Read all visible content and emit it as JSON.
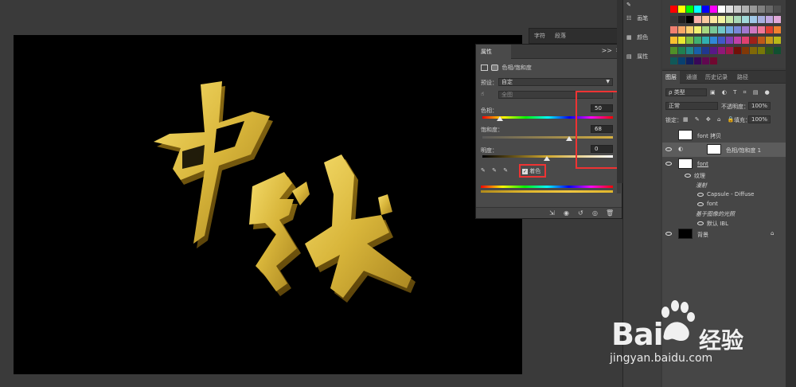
{
  "canvas": {
    "artwork_text": "中秋",
    "artwork_color": "#d8b53a"
  },
  "char_panel": {
    "tabs": [
      "字符",
      "段落"
    ]
  },
  "properties": {
    "tab": "属性",
    "menu": ">>",
    "close": "×",
    "adjustment_name": "色相/饱和度",
    "preset_label": "预设：",
    "preset_value": "自定",
    "channel_value": "全图",
    "hue_label": "色相：",
    "hue_value": "50",
    "sat_label": "饱和度：",
    "sat_value": "68",
    "light_label": "明度：",
    "light_value": "0",
    "colorize_label": "着色",
    "colorize_checked": true,
    "footer_icons": [
      "clip-icon",
      "visibility-preview-icon",
      "reset-icon",
      "eye-icon",
      "trash-icon"
    ]
  },
  "strip": {
    "items": [
      {
        "icon": "brush-icon",
        "label": ""
      },
      {
        "icon": "brush-presets-icon",
        "label": "画笔"
      },
      {
        "icon": "swatches-icon",
        "label": "颜色"
      },
      {
        "icon": "properties-icon",
        "label": "属性"
      }
    ]
  },
  "swatch_colors": [
    "#ff0000",
    "#ffff00",
    "#00ff00",
    "#00ffff",
    "#0000ff",
    "#ff00ff",
    "#ffffff",
    "#e0e0e0",
    "#c8c8c8",
    "#b0b0b0",
    "#989898",
    "#808080",
    "#686868",
    "#505050",
    "#383838",
    "#202020",
    "#000000",
    "#f7b0a8",
    "#f9c8a0",
    "#fce7a0",
    "#f4f4a0",
    "#c8e8a8",
    "#a8d8b8",
    "#a0d8d8",
    "#a0c8e8",
    "#a8b0e0",
    "#c0a8e0",
    "#e0a8d8",
    "#f08070",
    "#f8a868",
    "#fcd070",
    "#f0f070",
    "#a8d880",
    "#78c898",
    "#70c8c8",
    "#70a8e0",
    "#7888d8",
    "#a078d0",
    "#d078c0",
    "#f07898",
    "#e04030",
    "#f08030",
    "#f8c030",
    "#e8e830",
    "#80c040",
    "#40b070",
    "#30b0b0",
    "#3088d8",
    "#4058c8",
    "#8040b8",
    "#c040a8",
    "#e04070",
    "#a02018",
    "#c05818",
    "#c89818",
    "#b8b818",
    "#509028",
    "#208050",
    "#208888",
    "#1860a8",
    "#203890",
    "#581888",
    "#901878",
    "#a01848",
    "#701008",
    "#803808",
    "#806808",
    "#787808",
    "#305818",
    "#105030",
    "#105858",
    "#084070",
    "#102060",
    "#380858",
    "#600850",
    "#700830"
  ],
  "layers": {
    "tabs": [
      "图层",
      "通道",
      "历史记录",
      "路径"
    ],
    "filter_label": "类型",
    "blend_mode": "正常",
    "opacity_label": "不透明度：",
    "opacity_value": "100%",
    "lock_label": "锁定：",
    "fill_label": "填充：",
    "fill_value": "100%",
    "items": [
      {
        "name": "font 拷贝",
        "kind": "smart"
      },
      {
        "name": "色相/饱和度 1",
        "kind": "adjustment"
      },
      {
        "name": "font",
        "kind": "smart"
      },
      {
        "name": "纹理",
        "kind": "sub"
      },
      {
        "name": "漫射",
        "kind": "sub"
      },
      {
        "name": "Capsule - Diffuse",
        "kind": "sub"
      },
      {
        "name": "font",
        "kind": "sub"
      },
      {
        "name": "基于图像的光照",
        "kind": "sub"
      },
      {
        "name": "默认 IBL",
        "kind": "sub"
      },
      {
        "name": "背景",
        "kind": "background"
      }
    ]
  },
  "watermark": {
    "logo_left": "Bai",
    "logo_right": "经验",
    "url": "jingyan.baidu.com"
  }
}
